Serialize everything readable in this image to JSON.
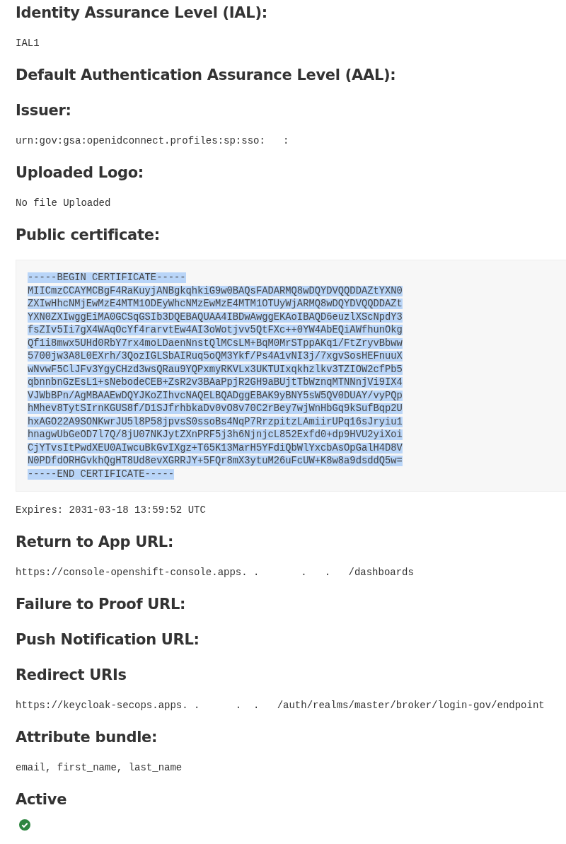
{
  "sections": [
    {
      "kind": "field",
      "label": "Identity Assurance Level (IAL):",
      "value": "IAL1"
    },
    {
      "kind": "field",
      "label": "Default Authentication Assurance Level (AAL):"
    },
    {
      "kind": "field",
      "label": "Issuer:",
      "value": "urn:gov:gsa:openidconnect.profiles:sp:sso:   :"
    },
    {
      "kind": "field",
      "label": "Uploaded Logo:",
      "value": "No file Uploaded"
    },
    {
      "kind": "certificate",
      "label": "Public certificate:",
      "highlighted": true,
      "lines": [
        "-----BEGIN CERTIFICATE-----",
        "MIICmzCCAYMCBgF4RaKuyjANBgkqhkiG9w0BAQsFADARMQ8wDQYDVQQDDAZtYXN0",
        "ZXIwHhcNMjEwMzE4MTM1ODEyWhcNMzEwMzE4MTM1OTUyWjARMQ8wDQYDVQQDDAZt",
        "YXN0ZXIwggEiMA0GCSqGSIb3DQEBAQUAA4IBDwAwggEKAoIBAQD6euzlXScNpdY3",
        "fsZIv5Ii7gX4WAqOcYf4rarvtEw4AI3oWotjvv5QtFXc++0YW4AbEQiAWfhunOkg",
        "Qf1i8mwx5UHd0RbY7rx4moLDaenNnstQlMCsLM+BqM0MrSTppAKq1/FtZryvBbww",
        "5700jw3A8L0EXrh/3QozIGLSbAIRuq5oQM3Ykf/Ps4A1vNI3j/7xgvSosHEFnuuX",
        "wNvwF5ClJFv3YgyCHzd3wsQRau9YQPxmyRKVLx3UKTUIxqkhzlkv3TZIOW2cfPb5",
        "qbnnbnGzEsL1+sNebodeCEB+ZsR2v3BAaPpjR2GH9aBUjtTbWznqMTNNnjVi9IX4",
        "VJWbBPn/AgMBAAEwDQYJKoZIhvcNAQELBQADggEBAK9yBNY5sW5QV0DUAY/vyPQp",
        "hMhev8TytSIrnKGUS8f/D1SJfrhbkaDv0vO8v70C2rBey7wjWnHbGq9kSufBqp2U",
        "hxAGO22A9SONKwrJU5l8P58jpvsS0ssoBs4NqP7RrzpitzLAmiirUPq16sJryiu1",
        "hnagwUbGeOD7l7Q/8jU07NKJytZXnPRF5j3h6NjnjcL852Exfd0+dp9HVU2yiXoi",
        "CjYTvsItPwdXEU0AIwcuBkGvIXgz+T65K13MarH5YFdiQbWlYxcbAsOpGalH4D8V",
        "N0PDfdORHGvkhQgHT8Ud8evXGRRJY+5FQr8mX3ytuM26uFcUW+K8w8a9dsddQ5w=",
        "-----END CERTIFICATE-----"
      ],
      "note": "Expires: 2031-03-18 13:59:52 UTC"
    },
    {
      "kind": "field",
      "label": "Return to App URL:",
      "value": "https://console-openshift-console.apps. .       .   .   /dashboards"
    },
    {
      "kind": "field",
      "label": "Failure to Proof URL:"
    },
    {
      "kind": "field",
      "label": "Push Notification URL:"
    },
    {
      "kind": "field",
      "label": "Redirect URIs",
      "value": "https://keycloak-secops.apps. .      .  .   /auth/realms/master/broker/login-gov/endpoint"
    },
    {
      "kind": "field",
      "label": "Attribute bundle:",
      "value": "email, first_name, last_name"
    },
    {
      "kind": "status",
      "label": "Active",
      "on": true
    }
  ]
}
